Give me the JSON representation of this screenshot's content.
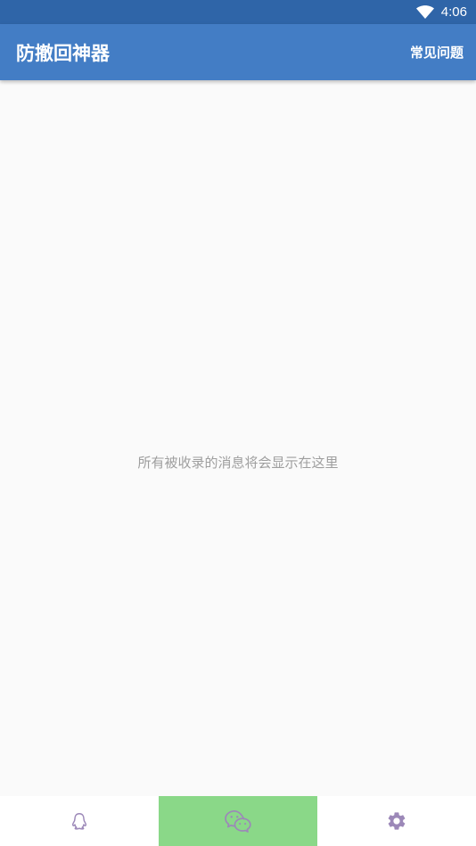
{
  "status_bar": {
    "time": "4:06",
    "wifi_icon": "wifi-icon"
  },
  "app_bar": {
    "title": "防撤回神器",
    "faq_label": "常见问题",
    "color": "#437dc5"
  },
  "content": {
    "empty_message": "所有被收录的消息将会显示在这里"
  },
  "bottom_nav": {
    "tabs": [
      {
        "icon": "qq-penguin-icon",
        "active": false
      },
      {
        "icon": "wechat-icon",
        "active": true
      },
      {
        "icon": "gear-icon",
        "active": false
      }
    ],
    "active_color": "#8ad888",
    "icon_color": "#9c88b8"
  }
}
